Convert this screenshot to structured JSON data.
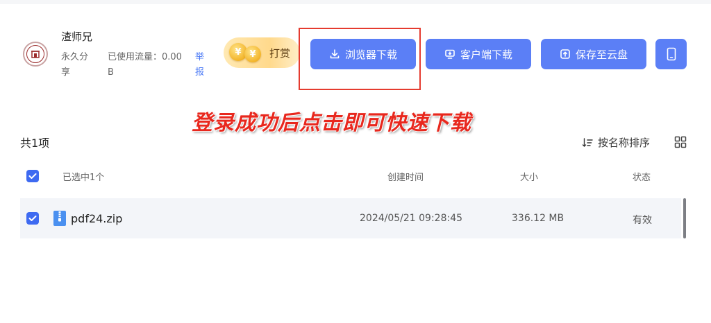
{
  "colors": {
    "primary_button": "#5b7ff6",
    "checkbox": "#3e6af1",
    "link": "#4e7cf6",
    "annotation_red": "#e8281e",
    "row_background": "#f3f5f9"
  },
  "header": {
    "avatar_icon": "university-logo-icon",
    "username": "渣师兄",
    "share_type": "永久分享",
    "traffic_used": "已使用流量：0.00 B",
    "report_label": "举报",
    "tip": {
      "icon": "coin-icon",
      "coin_glyph": "¥",
      "label": "打赏"
    },
    "buttons": {
      "browser_download": {
        "icon": "download-icon",
        "label": "浏览器下载"
      },
      "client_download": {
        "icon": "monitor-icon",
        "label": "客户端下载"
      },
      "save_to_cloud": {
        "icon": "upload-cloud-icon",
        "label": "保存至云盘"
      },
      "mobile": {
        "icon": "phone-icon"
      }
    }
  },
  "annotation": {
    "text": "登录成功后点击即可快速下载"
  },
  "list": {
    "count_label": "共1项",
    "sort_label": "按名称排序",
    "sort_icon": "sort-icon",
    "view_toggle_icon": "grid-view-icon",
    "header": {
      "selected_label": "已选中1个",
      "columns": {
        "created": "创建时间",
        "size": "大小",
        "status": "状态"
      }
    },
    "files": [
      {
        "icon": "zip-file-icon",
        "name": "pdf24.zip",
        "created": "2024/05/21 09:28:45",
        "size": "336.12 MB",
        "status": "有效",
        "checked": true
      }
    ]
  }
}
